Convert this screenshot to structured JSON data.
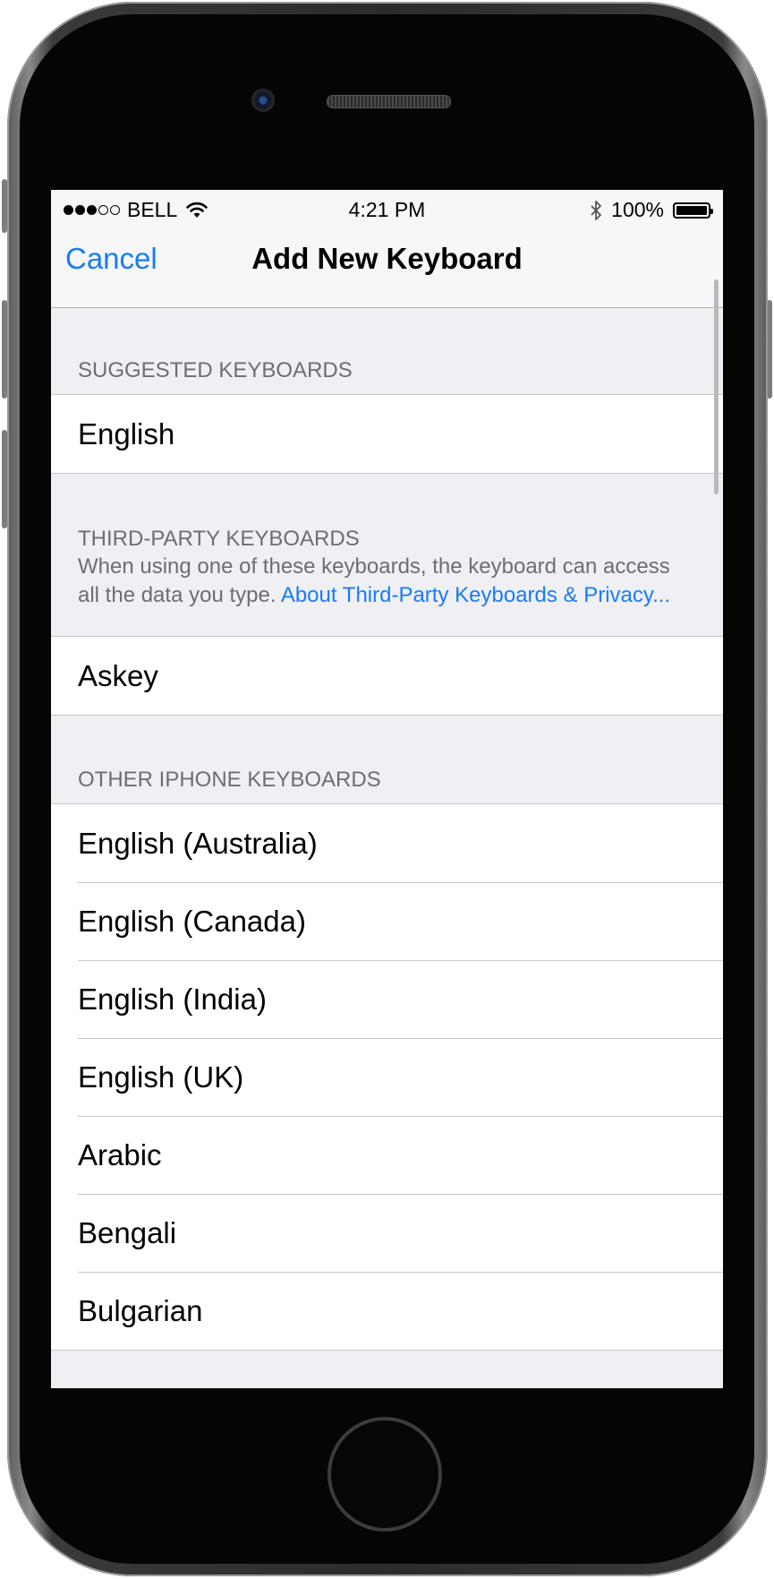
{
  "status_bar": {
    "carrier": "BELL",
    "time": "4:21 PM",
    "battery_percent": "100%",
    "battery_level": 1.0,
    "signal_bars_filled": 3,
    "signal_bars_total": 5
  },
  "nav": {
    "cancel_label": "Cancel",
    "title": "Add New Keyboard"
  },
  "sections": {
    "suggested": {
      "header": "SUGGESTED KEYBOARDS",
      "items": [
        "English"
      ]
    },
    "third_party": {
      "header": "THIRD-PARTY KEYBOARDS",
      "description": "When using one of these keyboards, the keyboard can access all the data you type.",
      "link_text": "About Third-Party Keyboards & Privacy...",
      "items": [
        "Askey"
      ]
    },
    "other": {
      "header": "OTHER IPHONE KEYBOARDS",
      "items": [
        "English (Australia)",
        "English (Canada)",
        "English (India)",
        "English (UK)",
        "Arabic",
        "Bengali",
        "Bulgarian"
      ]
    }
  },
  "colors": {
    "accent": "#1a7cf5",
    "grouped_background": "#efeff4",
    "section_text": "#6d6d72"
  }
}
